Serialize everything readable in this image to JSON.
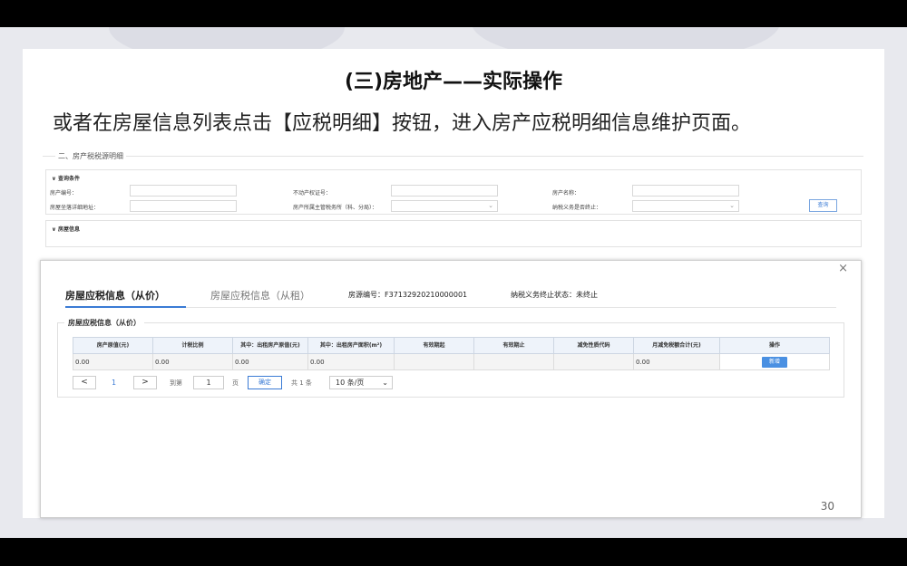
{
  "slide": {
    "title": "(三)房地产——实际操作",
    "subtitle": "或者在房屋信息列表点击【应税明细】按钮，进入房产应税明细信息维护页面。",
    "page_number": "30"
  },
  "background": {
    "section_title": "二、房产税税源明细",
    "query_panel_title": "∨ 查询条件",
    "fields": {
      "house_no_label": "房产编号：",
      "cert_no_label": "不动产权证号：",
      "house_name_label": "房产名称：",
      "address_label": "房屋坐落详细地址：",
      "tax_office_label": "房产所属主管税务所（科、分局）：",
      "tax_end_label": "纳税义务是否终止："
    },
    "query_button": "查询",
    "house_panel_title": "∨ 房屋信息"
  },
  "modal": {
    "close_label": "×",
    "tabs": [
      {
        "label": "房屋应税信息（从价）"
      },
      {
        "label": "房屋应税信息（从租）"
      }
    ],
    "house_source_label": "房源编号：F37132920210000001",
    "tax_status_label": "纳税义务终止状态：未终止",
    "fieldset_legend": "房屋应税信息（从价）",
    "table": {
      "headers": [
        "房产原值(元)",
        "计税比例",
        "其中：出租房产原值(元)",
        "其中：出租房产面积(m²)",
        "有效期起",
        "有效期止",
        "减免性质代码",
        "月减免税额合计(元)",
        "操作"
      ],
      "row": [
        "0.00",
        "0.00",
        "0.00",
        "0.00",
        "",
        "",
        "",
        "0.00"
      ],
      "add_button": "新增"
    },
    "pager": {
      "prev": "<",
      "page": "1",
      "next": ">",
      "goto_label": "到第",
      "goto_value": "1",
      "page_unit": "页",
      "confirm": "确定",
      "total": "共 1 条",
      "page_size": "10 条/页"
    }
  }
}
